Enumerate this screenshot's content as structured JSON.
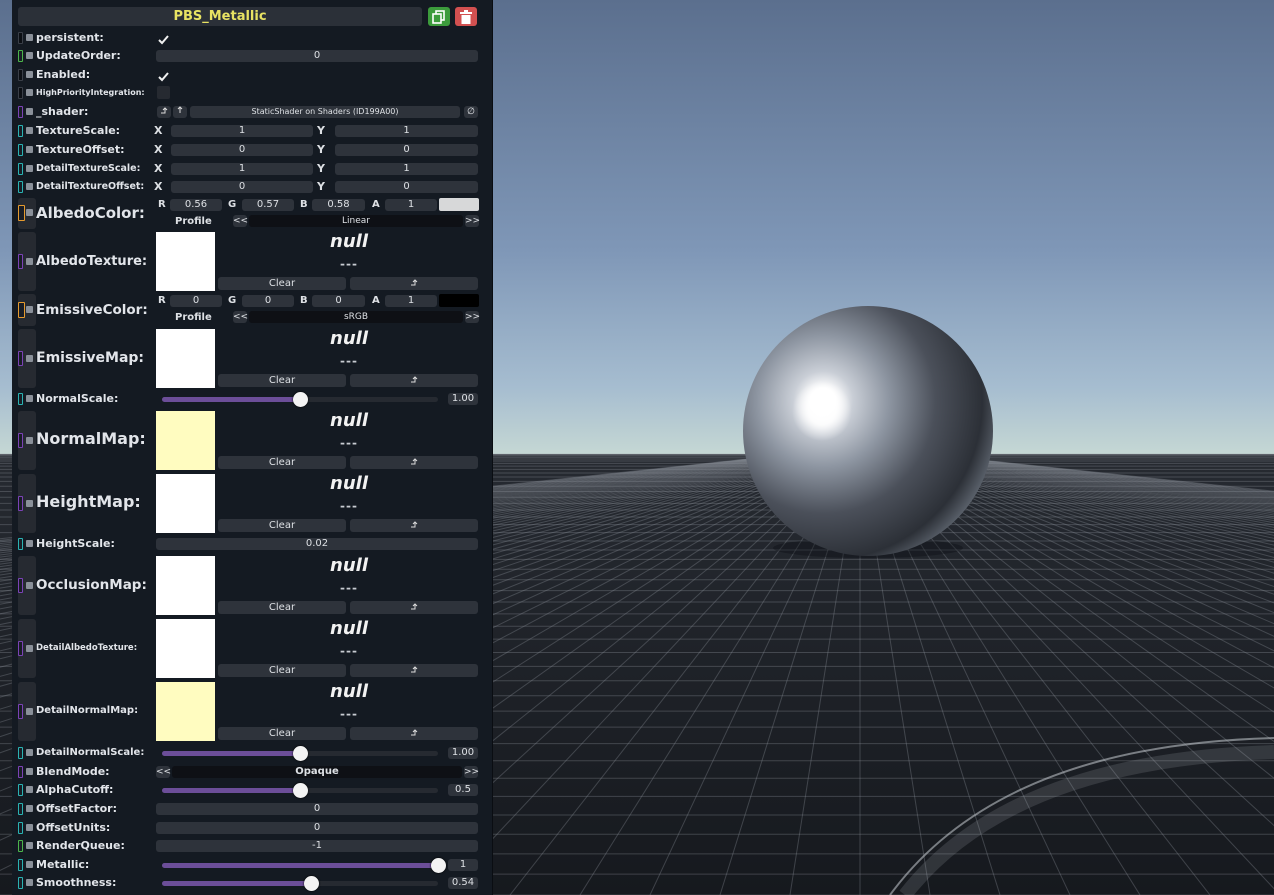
{
  "inspector": {
    "title": "PBS_Metallic",
    "persistent_label": "persistent:",
    "update_order_label": "UpdateOrder:",
    "update_order_value": "0",
    "enabled_label": "Enabled:",
    "high_priority_label": "HighPriorityIntegration:",
    "shader_label": "_shader:",
    "shader_value": "StaticShader on Shaders (ID199A00)",
    "shader_clear_glyph": "∅",
    "axis_x": "X",
    "axis_y": "Y",
    "texture_scale": {
      "label": "TextureScale:",
      "x": "1",
      "y": "1"
    },
    "texture_offset": {
      "label": "TextureOffset:",
      "x": "0",
      "y": "0"
    },
    "detail_texture_scale": {
      "label": "DetailTextureScale:",
      "x": "1",
      "y": "1"
    },
    "detail_texture_offset": {
      "label": "DetailTextureOffset:",
      "x": "0",
      "y": "0"
    },
    "channel_r": "R",
    "channel_g": "G",
    "channel_b": "B",
    "channel_a": "A",
    "profile_label": "Profile",
    "prev_glyph": "<<",
    "next_glyph": ">>",
    "albedo_color": {
      "label": "AlbedoColor:",
      "r": "0.56",
      "g": "0.57",
      "b": "0.58",
      "a": "1",
      "profile": "Linear",
      "swatch": "#d7d8d9"
    },
    "emissive_color": {
      "label": "EmissiveColor:",
      "r": "0",
      "g": "0",
      "b": "0",
      "a": "1",
      "profile": "sRGB",
      "swatch": "#000000"
    },
    "null_text": "null",
    "null_dashes": "---",
    "clear_label": "Clear",
    "textures": {
      "albedo": "AlbedoTexture:",
      "emissive": "EmissiveMap:",
      "normal": "NormalMap:",
      "height": "HeightMap:",
      "occlusion": "OcclusionMap:",
      "detail_albedo": "DetailAlbedoTexture:",
      "detail_normal": "DetailNormalMap:"
    },
    "normal_scale": {
      "label": "NormalScale:",
      "value": "1.00",
      "fraction": 0.5
    },
    "height_scale": {
      "label": "HeightScale:",
      "value": "0.02"
    },
    "detail_normal_scale": {
      "label": "DetailNormalScale:",
      "value": "1.00",
      "fraction": 0.5
    },
    "blend_mode": {
      "label": "BlendMode:",
      "value": "Opaque"
    },
    "alpha_cutoff": {
      "label": "AlphaCutoff:",
      "value": "0.5",
      "fraction": 0.5
    },
    "offset_factor": {
      "label": "OffsetFactor:",
      "value": "0"
    },
    "offset_units": {
      "label": "OffsetUnits:",
      "value": "0"
    },
    "render_queue": {
      "label": "RenderQueue:",
      "value": "-1"
    },
    "metallic": {
      "label": "Metallic:",
      "value": "1",
      "fraction": 1.0
    },
    "smoothness": {
      "label": "Smoothness:",
      "value": "0.54",
      "fraction": 0.54
    }
  }
}
